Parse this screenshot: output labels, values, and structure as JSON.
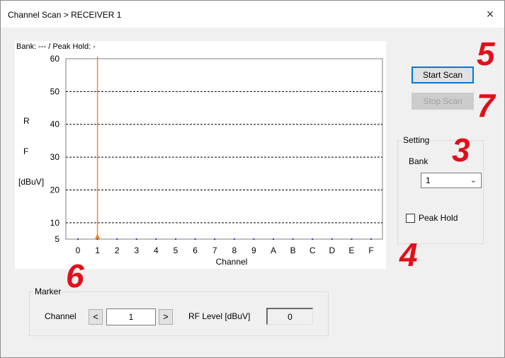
{
  "window": {
    "title": "Channel Scan > RECEIVER 1",
    "close_glyph": "×"
  },
  "status": {
    "bank_peak": "Bank: --- / Peak Hold:  -"
  },
  "chart_data": {
    "type": "scatter",
    "title": "",
    "xlabel": "Channel",
    "ylabel_lines": [
      "R",
      "F",
      "[dBuV]"
    ],
    "categories": [
      "0",
      "1",
      "2",
      "3",
      "4",
      "5",
      "6",
      "7",
      "8",
      "9",
      "A",
      "B",
      "C",
      "D",
      "E",
      "F"
    ],
    "values": [
      5,
      5,
      5,
      5,
      5,
      5,
      5,
      5,
      5,
      5,
      5,
      5,
      5,
      5,
      5,
      5
    ],
    "ylim": [
      5,
      60
    ],
    "yticks": [
      60,
      50,
      40,
      30,
      20,
      10,
      5
    ],
    "grid": "dashed horizontal",
    "marker_channel_index": 1,
    "colors": {
      "points": "#1f3fc8",
      "marker": "#f08c28",
      "grid": "#000000"
    }
  },
  "buttons": {
    "start_scan": "Start Scan",
    "stop_scan": "Stop Scan"
  },
  "setting": {
    "legend": "Setting",
    "bank_label": "Bank",
    "bank_value": "1",
    "bank_arrow": "chevron-down-icon",
    "peak_hold_label": "Peak Hold",
    "peak_hold_checked": false
  },
  "marker": {
    "legend": "Marker",
    "channel_label": "Channel",
    "prev": "<",
    "next": ">",
    "channel_value": "1",
    "rf_label": "RF Level [dBuV]",
    "rf_value": "0"
  },
  "callouts": {
    "c5": "5",
    "c7": "7",
    "c3": "3",
    "c4": "4",
    "c6": "6",
    "color": "#e0101a"
  }
}
